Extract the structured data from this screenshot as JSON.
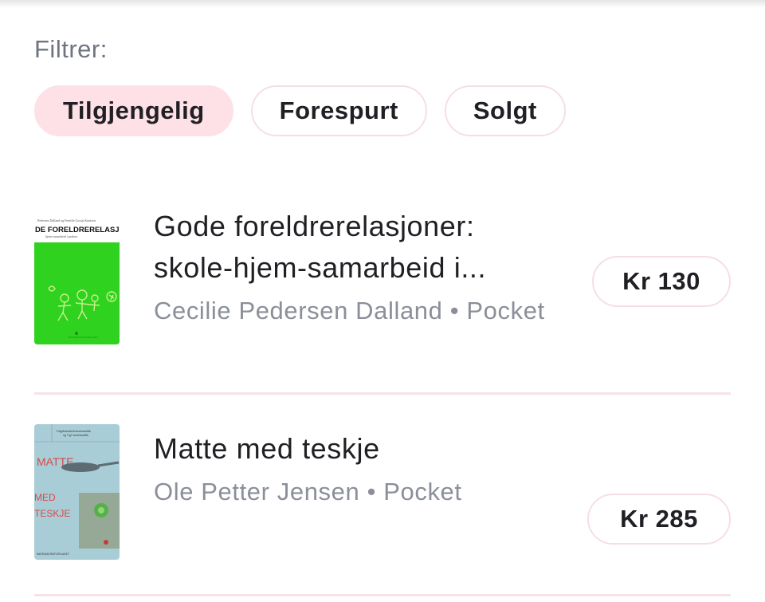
{
  "filter": {
    "label": "Filtrer:",
    "chips": [
      "Tilgjengelig",
      "Forespurt",
      "Solgt"
    ],
    "active": "Tilgjengelig"
  },
  "books": [
    {
      "title": "Gode foreldrerelasjoner: skole-hjem-samarbeid i...",
      "author": "Cecilie Pedersen Dalland",
      "format": "Pocket",
      "price": "Kr 130",
      "cover": {
        "title_text": "DE FORELDRERELASJONI",
        "top_text": "Pedersen Dalland og Pernille Gossje Knutsen",
        "sub_text": "hjem-samarbeid i praksis",
        "bg_color": "#2fd21f"
      }
    },
    {
      "title": "Matte med teskje",
      "author": "Ole Petter Jensen",
      "format": "Pocket",
      "price": "Kr 285",
      "cover": {
        "line1": "MATTE",
        "line2": "MED",
        "line3": "TESKJE",
        "header": "Ungdomsskolematematikk og Vg1-matematikk",
        "footer": "MATEMATIKKFORLAGET",
        "bg_color": "#a9cdd6"
      }
    }
  ]
}
